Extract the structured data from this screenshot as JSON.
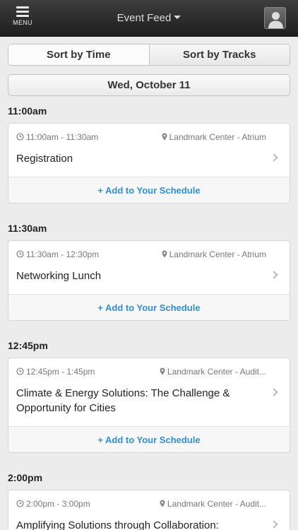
{
  "header": {
    "menu_label": "MENU",
    "title": "Event Feed"
  },
  "sort": {
    "by_time": "Sort by Time",
    "by_tracks": "Sort by Tracks"
  },
  "date_label": "Wed, October 11",
  "add_label": "Add to Your Schedule",
  "slots": [
    {
      "time": "11:00am",
      "session": {
        "time_range": "11:00am - 11:30am",
        "location": "Landmark Center - Atrium",
        "title": "Registration"
      }
    },
    {
      "time": "11:30am",
      "session": {
        "time_range": "11:30am - 12:30pm",
        "location": "Landmark Center - Atrium",
        "title": "Networking Lunch"
      }
    },
    {
      "time": "12:45pm",
      "session": {
        "time_range": "12:45pm - 1:45pm",
        "location": "Landmark Center - Audit...",
        "title": "Climate & Energy Solutions: The Challenge & Opportunity for Cities"
      }
    },
    {
      "time": "2:00pm",
      "session": {
        "time_range": "2:00pm - 3:00pm",
        "location": "Landmark Center - Audit...",
        "title": "Amplifying Solutions through Collaboration:"
      }
    }
  ]
}
